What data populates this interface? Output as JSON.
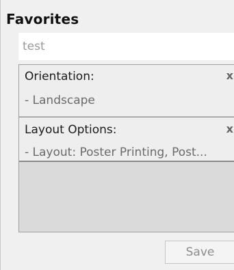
{
  "panel": {
    "title": "Favorites",
    "name_input_value": "test"
  },
  "items": [
    {
      "label": "Orientation:",
      "value": "- Landscape",
      "close": "x"
    },
    {
      "label": "Layout Options:",
      "value": "- Layout: Poster Printing, Post...",
      "close": "x"
    }
  ],
  "save_label": "Save"
}
